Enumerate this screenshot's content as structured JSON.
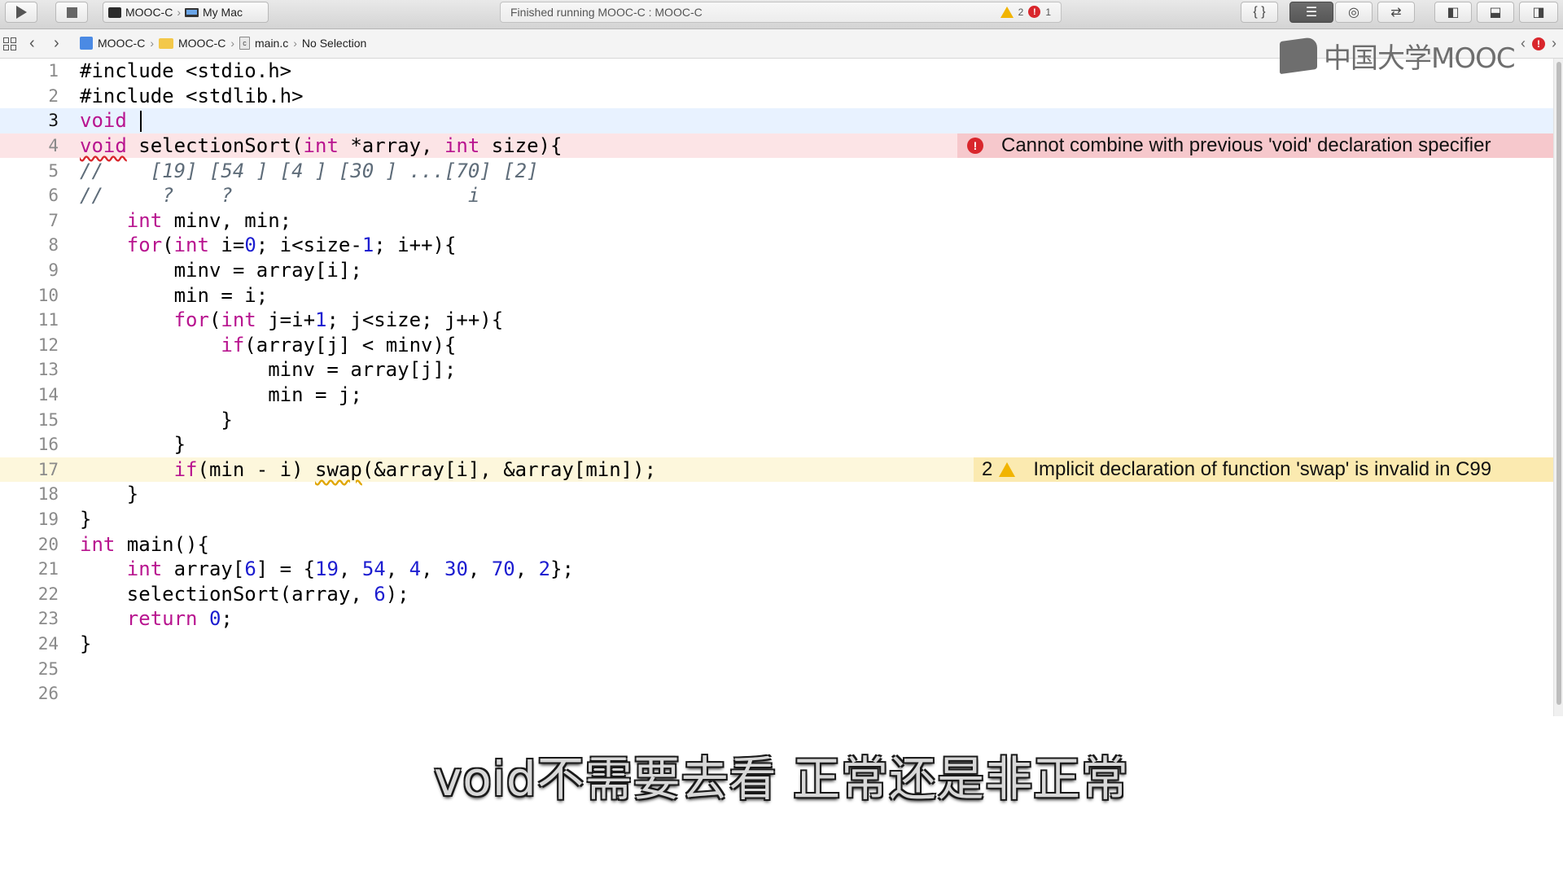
{
  "toolbar": {
    "scheme_name": "MOOC-C",
    "destination": "My Mac",
    "status_text": "Finished running MOOC-C : MOOC-C",
    "warning_count": "2",
    "error_count": "1"
  },
  "jumpbar": {
    "crumbs": [
      "MOOC-C",
      "MOOC-C",
      "main.c",
      "No Selection"
    ]
  },
  "watermark": {
    "text": "中国大学MOOC"
  },
  "editor": {
    "current_line": 3,
    "lines": [
      {
        "n": "1",
        "text": "#include <stdio.h>"
      },
      {
        "n": "2",
        "text": "#include <stdlib.h>"
      },
      {
        "n": "3",
        "text": "void "
      },
      {
        "n": "4",
        "text": "void selectionSort(int *array, int size){"
      },
      {
        "n": "5",
        "text": "//    [19] [54 ] [4 ] [30 ] ...[70] [2]"
      },
      {
        "n": "6",
        "text": "//     ?    ?                    i"
      },
      {
        "n": "7",
        "text": "    int minv, min;"
      },
      {
        "n": "8",
        "text": "    for(int i=0; i<size-1; i++){"
      },
      {
        "n": "9",
        "text": "        minv = array[i];"
      },
      {
        "n": "10",
        "text": "        min = i;"
      },
      {
        "n": "11",
        "text": "        for(int j=i+1; j<size; j++){"
      },
      {
        "n": "12",
        "text": "            if(array[j] < minv){"
      },
      {
        "n": "13",
        "text": "                minv = array[j];"
      },
      {
        "n": "14",
        "text": "                min = j;"
      },
      {
        "n": "15",
        "text": "            }"
      },
      {
        "n": "16",
        "text": "        }"
      },
      {
        "n": "17",
        "text": "        if(min - i) swap(&array[i], &array[min]);"
      },
      {
        "n": "18",
        "text": "    }"
      },
      {
        "n": "19",
        "text": "}"
      },
      {
        "n": "20",
        "text": "int main(){"
      },
      {
        "n": "21",
        "text": "    int array[6] = {19, 54, 4, 30, 70, 2};"
      },
      {
        "n": "22",
        "text": "    selectionSort(array, 6);"
      },
      {
        "n": "23",
        "text": "    return 0;"
      },
      {
        "n": "24",
        "text": "}"
      },
      {
        "n": "25",
        "text": ""
      },
      {
        "n": "26",
        "text": ""
      }
    ],
    "error_message": "Cannot combine with previous 'void' declaration specifier",
    "warning_count": "2",
    "warning_message": "Implicit declaration of function 'swap' is invalid in C99"
  },
  "subtitle": "void不需要去看 正常还是非正常",
  "colors": {
    "keyword": "#b8148f",
    "number": "#1c1dd0",
    "comment": "#5e6c79",
    "error": "#d9262c",
    "warning": "#f1b400"
  }
}
